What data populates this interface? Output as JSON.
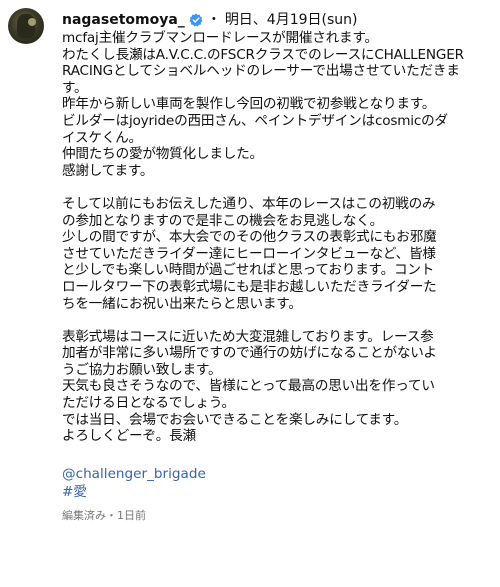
{
  "post": {
    "username": "nagasetomoya_",
    "separator": "・",
    "date": "明日、4月19日(sun)",
    "lines": [
      "mcfaj主催クラブマンロードレースが開催されます。",
      "わたくし長瀬はA.V.C.C.のFSCRクラスでのレースにCHALLENGER",
      "RACINGとしてショベルヘッドのレーサーで出場させていただきま",
      "す。",
      "昨年から新しい車両を製作し今回の初戦で初参戦となります。",
      "ビルダーはjoyrideの西田さん、ペイントデザインはcosmicのダ",
      "イスケくん。",
      "仲間たちの愛が物質化しました。",
      "感謝してます。",
      "",
      "そして以前にもお伝えした通り、本年のレースはこの初戦のみ",
      "の参加となりますので是非この機会をお見逃しなく。",
      "少しの間ですが、本大会でのその他クラスの表彰式にもお邪魔",
      "させていただきライダー達にヒーローインタビューなど、皆様",
      "と少しでも楽しい時間が過ごせればと思っております。コント",
      "ロールタワー下の表彰式場にも是非お越しいただきライダーた",
      "ちを一緒にお祝い出来たらと思います。",
      "",
      "表彰式場はコースに近いため大変混雑しております。レース参",
      "加者が非常に多い場所ですので通行の妨げになることがないよ",
      "うご協力お願い致します。",
      "天気も良さそうなので、皆様にとって最高の思い出を作ってい",
      "ただける日となるでしょう。",
      "では当日、会場でお会いできることを楽しみにしてます。",
      "よろしくどーぞ。長瀬",
      ""
    ],
    "mention": "@challenger_brigade",
    "hashtag": "#愛",
    "meta": "編集済み・1日前"
  },
  "colors": {
    "link": "#3b63a8",
    "verified": "#3897f0",
    "meta": "#777777"
  },
  "icons": {
    "avatar": "profile-avatar",
    "verified": "verified-badge-icon"
  }
}
